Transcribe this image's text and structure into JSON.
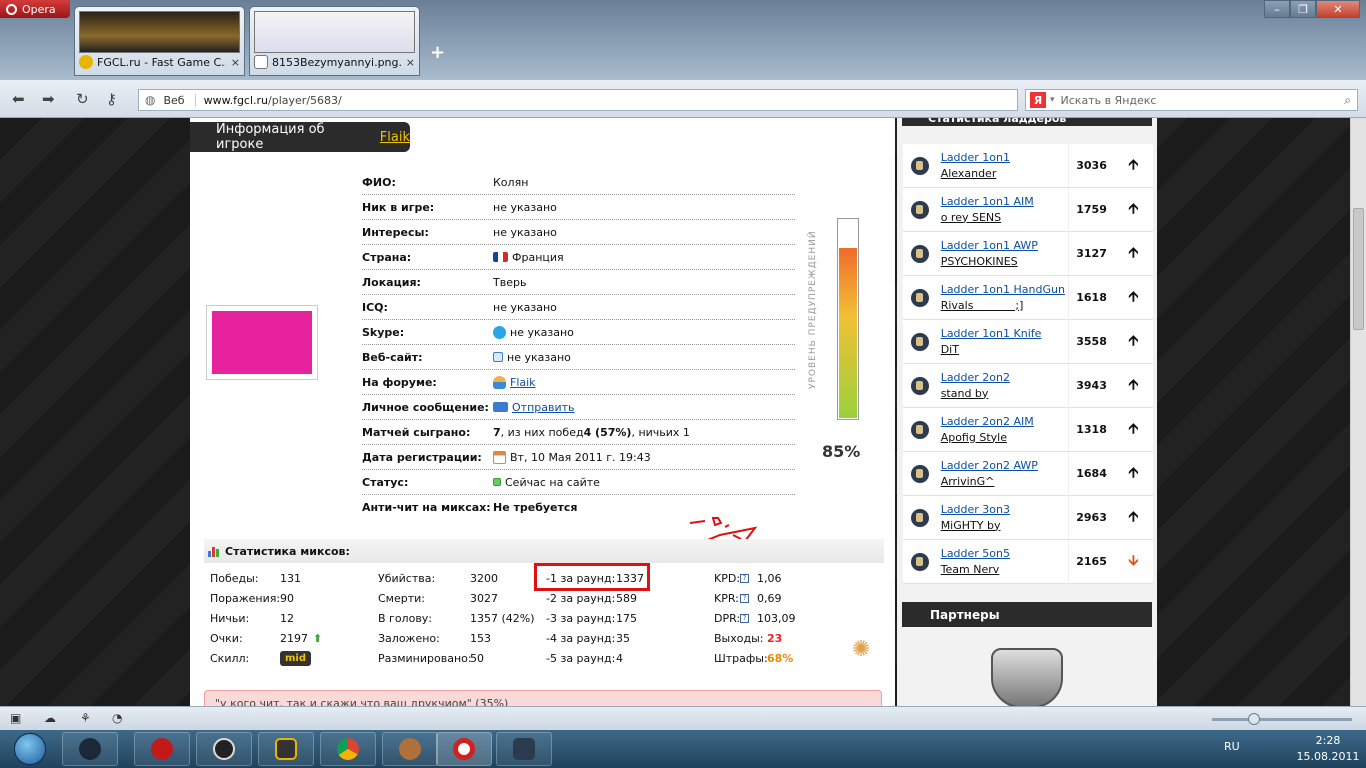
{
  "browser": {
    "menu_label": "Opera",
    "tabs": [
      {
        "title": "FGCL.ru - Fast Game C...",
        "close": "×"
      },
      {
        "title": "8153Bezymyannyi.png...",
        "close": "×"
      }
    ],
    "new_tab": "+",
    "window_controls": {
      "minimize": "–",
      "maximize": "❐",
      "close": "✕"
    },
    "zone_label": "Веб",
    "url_host": "www.fgcl.ru",
    "url_path": "/player/5683/",
    "search_placeholder": "Искать в Яндекс",
    "search_engine_glyph": "Я"
  },
  "player": {
    "header_prefix": "Информация об игроке",
    "nick": "Flaik",
    "info": [
      {
        "key": "ФИО:",
        "value": "Колян"
      },
      {
        "key": "Ник в игре:",
        "value": "не указано"
      },
      {
        "key": "Интересы:",
        "value": "не указано"
      },
      {
        "key": "Страна:",
        "value": "Франция"
      },
      {
        "key": "Локация:",
        "value": "Тверь"
      },
      {
        "key": "ICQ:",
        "value": "не указано"
      },
      {
        "key": "Skype:",
        "value": "не указано"
      },
      {
        "key": "Веб-сайт:",
        "value": "не указано"
      },
      {
        "key": "На форуме:",
        "value": "Flaik"
      },
      {
        "key": "Личное сообщение:",
        "value": "Отправить"
      },
      {
        "key": "Матчей сыграно:",
        "value_a": "7",
        "value_b": ", из них побед ",
        "value_c": "4 (57%)",
        "value_d": ", ничьих 1"
      },
      {
        "key": "Дата регистрации:",
        "value": "Вт, 10 Мая 2011 г. 19:43"
      },
      {
        "key": "Статус:",
        "value": "Сейчас на сайте"
      },
      {
        "key": "Анти-чит на миксах:",
        "value": "Не требуется"
      }
    ],
    "warning_label": "УРОВЕНЬ ПРЕДУПРЕЖДЕНИЙ",
    "warning_level": 0.85,
    "warning_text": "85%"
  },
  "stats": {
    "title": "Статистика миксов:",
    "col1": [
      {
        "k": "Победы:",
        "v": "131"
      },
      {
        "k": "Поражения:",
        "v": "90"
      },
      {
        "k": "Ничьи:",
        "v": "12"
      },
      {
        "k": "Очки:",
        "v": "2197"
      },
      {
        "k": "Скилл:",
        "v": "mid"
      }
    ],
    "col2": [
      {
        "k": "Убийства:",
        "v": "3200"
      },
      {
        "k": "Смерти:",
        "v": "3027"
      },
      {
        "k": "В голову:",
        "v": "1357 (42%)"
      },
      {
        "k": "Заложено:",
        "v": "153"
      },
      {
        "k": "Разминировано:",
        "v": "50"
      }
    ],
    "col3": [
      {
        "k": "-1 за раунд:",
        "v": "1337"
      },
      {
        "k": "-2 за раунд:",
        "v": "589"
      },
      {
        "k": "-3 за раунд:",
        "v": "175"
      },
      {
        "k": "-4 за раунд:",
        "v": "35"
      },
      {
        "k": "-5 за раунд:",
        "v": "4"
      }
    ],
    "col4": [
      {
        "k": "KPD:",
        "v": "1,06"
      },
      {
        "k": "KPR:",
        "v": "0,69"
      },
      {
        "k": "DPR:",
        "v": "103,09"
      },
      {
        "k": "Выходы:",
        "v": "23"
      },
      {
        "k": "Штрафы:",
        "v": "68%"
      }
    ],
    "help_glyph": "?",
    "quote": "\"у кого чит, так и скажи что ваш друкчиом\" (35%)"
  },
  "sidebar": {
    "ladders_title": "Статистика ладдеров",
    "ladders": [
      {
        "name": "Ladder 1on1",
        "leader": "Alexander",
        "points": "3036",
        "trend": "up"
      },
      {
        "name": "Ladder 1on1 AIM",
        "leader": "o rey SENS",
        "points": "1759",
        "trend": "up"
      },
      {
        "name": "Ladder 1on1 AWP",
        "leader": "PSYCHOKINES",
        "points": "3127",
        "trend": "up"
      },
      {
        "name": "Ladder 1on1 HandGun",
        "leader": "Rivals            ;]",
        "points": "1618",
        "trend": "up"
      },
      {
        "name": "Ladder 1on1 Knife",
        "leader": "DiT",
        "points": "3558",
        "trend": "up"
      },
      {
        "name": "Ladder 2on2",
        "leader": "stand by",
        "points": "3943",
        "trend": "up"
      },
      {
        "name": "Ladder 2on2 AIM",
        "leader": "Apofig Style",
        "points": "1318",
        "trend": "up"
      },
      {
        "name": "Ladder 2on2 AWP",
        "leader": "ArrivinG^",
        "points": "1684",
        "trend": "up"
      },
      {
        "name": "Ladder 3on3",
        "leader": "MiGHTY by",
        "points": "2963",
        "trend": "up"
      },
      {
        "name": "Ladder 5on5",
        "leader": "Team Nerv",
        "points": "2165",
        "trend": "down"
      }
    ],
    "partners_title": "Партнеры"
  },
  "taskbar": {
    "lang": "RU",
    "time": "2:28",
    "date": "15.08.2011"
  },
  "colors": {
    "accent_red": "#e01010",
    "nick_yellow": "#f2c200",
    "avatar_pink": "#e6239c"
  }
}
